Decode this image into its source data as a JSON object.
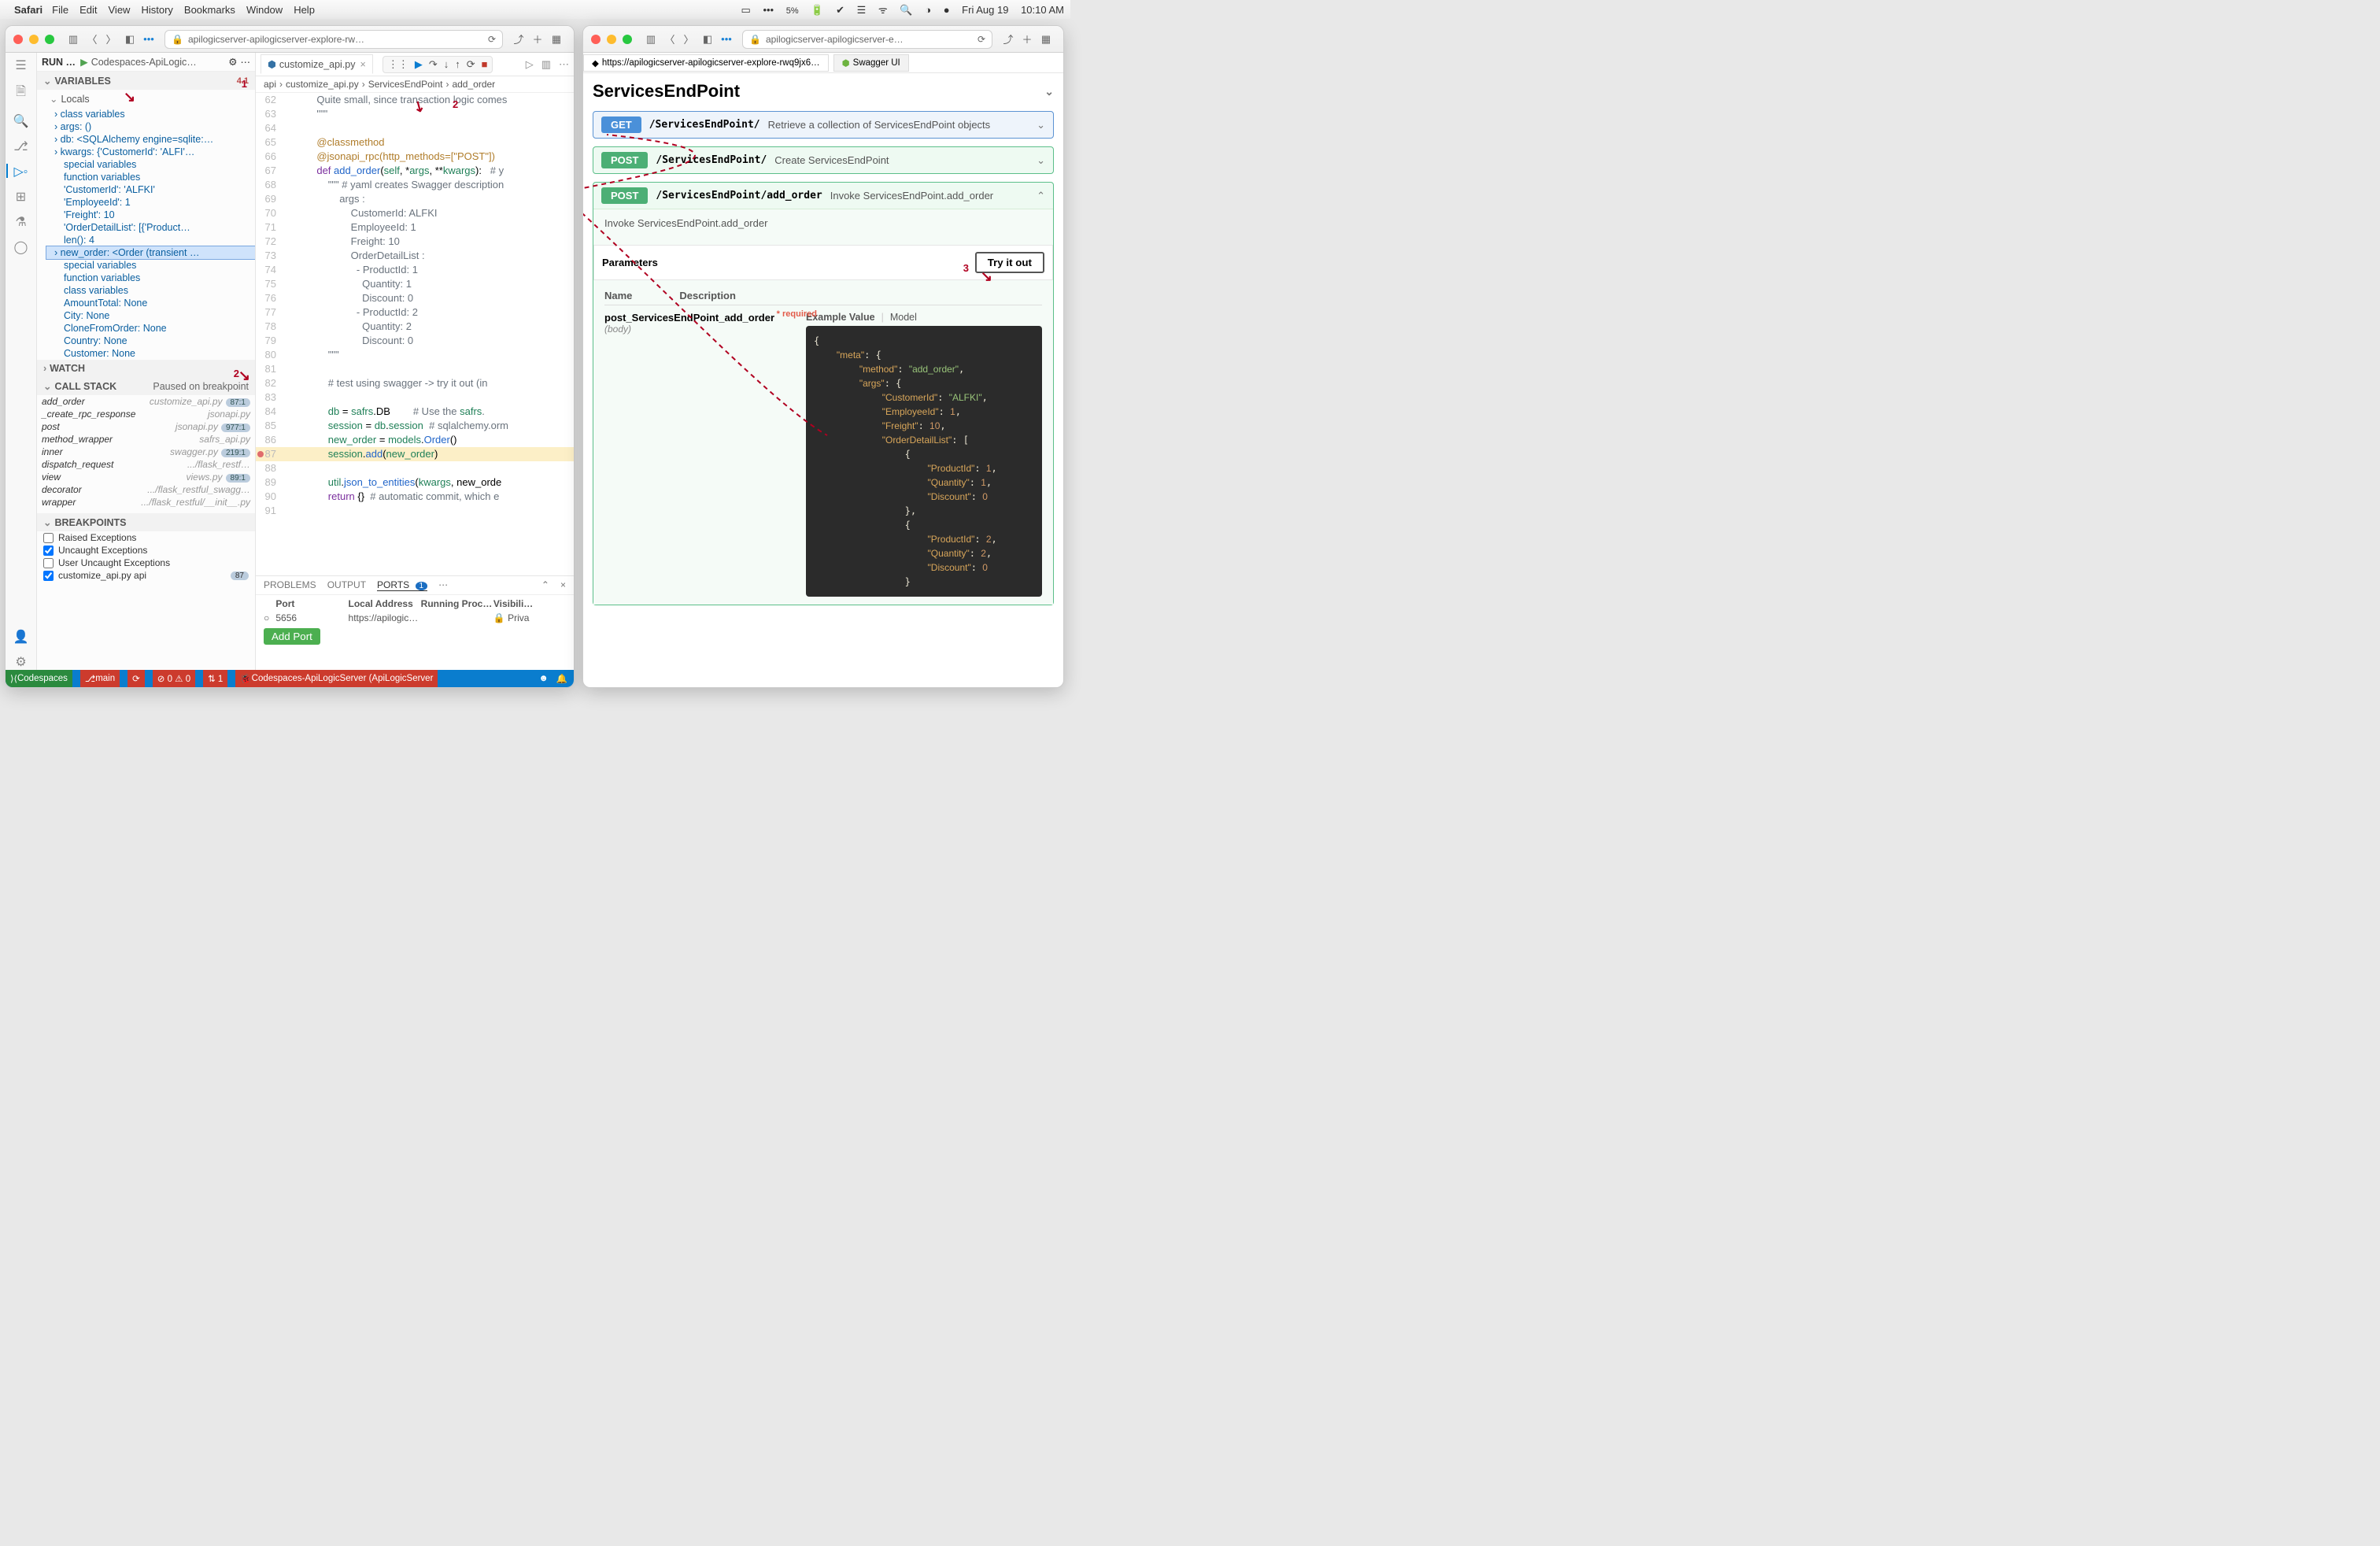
{
  "menubar": {
    "app": "Safari",
    "items": [
      "File",
      "Edit",
      "View",
      "History",
      "Bookmarks",
      "Window",
      "Help"
    ],
    "battery_pct": "5%",
    "date": "Fri Aug 19",
    "time": "10:10 AM"
  },
  "left_window": {
    "address": "apilogicserver-apilogicserver-explore-rw…",
    "run_cfg": "Codespaces-ApiLogic…",
    "run_label": "RUN …",
    "variables_title": "VARIABLES",
    "variables_badge": "4.1",
    "locals_title": "Locals",
    "locals": [
      {
        "name": "class variables",
        "val": ""
      },
      {
        "name": "args: ()",
        "val": ""
      },
      {
        "name": "db: <SQLAlchemy engine=sqlite:…",
        "val": ""
      },
      {
        "name": "kwargs: {'CustomerId': 'ALFI'…",
        "val": ""
      },
      {
        "name": "special variables",
        "val": "",
        "indent": 1
      },
      {
        "name": "function variables",
        "val": "",
        "indent": 1
      },
      {
        "name": "'CustomerId': 'ALFKI'",
        "val": "",
        "indent": 1
      },
      {
        "name": "'EmployeeId': 1",
        "val": "",
        "indent": 1
      },
      {
        "name": "'Freight': 10",
        "val": "",
        "indent": 1
      },
      {
        "name": "'OrderDetailList': [{'Product…",
        "val": "",
        "indent": 1
      },
      {
        "name": "len(): 4",
        "val": "",
        "indent": 1
      },
      {
        "name": "new_order: <Order (transient …",
        "val": "",
        "selected": true
      },
      {
        "name": "special variables",
        "val": "",
        "indent": 1
      },
      {
        "name": "function variables",
        "val": "",
        "indent": 1
      },
      {
        "name": "class variables",
        "val": "",
        "indent": 1
      },
      {
        "name": "AmountTotal: None",
        "val": "",
        "indent": 1
      },
      {
        "name": "City: None",
        "val": "",
        "indent": 1
      },
      {
        "name": "CloneFromOrder: None",
        "val": "",
        "indent": 1
      },
      {
        "name": "Country: None",
        "val": "",
        "indent": 1
      },
      {
        "name": "Customer: None",
        "val": "",
        "indent": 1
      }
    ],
    "watch_title": "WATCH",
    "callstack_title": "CALL STACK",
    "callstack_status": "Paused on breakpoint",
    "callstack": [
      {
        "fn": "add_order",
        "file": "customize_api.py",
        "tag": "87:1"
      },
      {
        "fn": "_create_rpc_response",
        "file": "jsonapi.py",
        "tag": ""
      },
      {
        "fn": "post",
        "file": "jsonapi.py",
        "tag": "977:1"
      },
      {
        "fn": "method_wrapper",
        "file": "safrs_api.py",
        "tag": ""
      },
      {
        "fn": "inner",
        "file": "swagger.py",
        "tag": "219:1"
      },
      {
        "fn": "dispatch_request",
        "file": ".../flask_restf…",
        "tag": ""
      },
      {
        "fn": "view",
        "file": "views.py",
        "tag": "89:1"
      },
      {
        "fn": "decorator",
        "file": ".../flask_restful_swagg…",
        "tag": ""
      },
      {
        "fn": "wrapper",
        "file": ".../flask_restful/__init__.py",
        "tag": ""
      }
    ],
    "breakpoints_title": "BREAKPOINTS",
    "breakpoints": [
      {
        "label": "Raised Exceptions",
        "checked": false
      },
      {
        "label": "Uncaught Exceptions",
        "checked": true
      },
      {
        "label": "User Uncaught Exceptions",
        "checked": false
      },
      {
        "label": "customize_api.py  api",
        "checked": true,
        "tag": "87"
      }
    ],
    "tab_filename": "customize_api.py",
    "breadcrumb": [
      "api",
      "customize_api.py",
      "ServicesEndPoint",
      "add_order"
    ],
    "code": [
      {
        "n": 62,
        "t": "            Quite small, since transaction logic comes",
        "cls": "tok-cm"
      },
      {
        "n": 63,
        "t": "            \"\"\"",
        "cls": "tok-cm"
      },
      {
        "n": 64,
        "t": ""
      },
      {
        "n": 65,
        "t": "            @classmethod",
        "cls": "tok-dec"
      },
      {
        "n": 66,
        "t": "            @jsonapi_rpc(http_methods=[\"POST\"])",
        "cls": "tok-dec"
      },
      {
        "n": 67,
        "t": "            def add_order(self, *args, **kwargs):   # y",
        "mix": true
      },
      {
        "n": 68,
        "t": "                \"\"\" # yaml creates Swagger description",
        "cls": "tok-cm"
      },
      {
        "n": 69,
        "t": "                    args :",
        "cls": "tok-cm"
      },
      {
        "n": 70,
        "t": "                        CustomerId: ALFKI",
        "cls": "tok-cm"
      },
      {
        "n": 71,
        "t": "                        EmployeeId: 1",
        "cls": "tok-cm"
      },
      {
        "n": 72,
        "t": "                        Freight: 10",
        "cls": "tok-cm"
      },
      {
        "n": 73,
        "t": "                        OrderDetailList :",
        "cls": "tok-cm"
      },
      {
        "n": 74,
        "t": "                          - ProductId: 1",
        "cls": "tok-cm"
      },
      {
        "n": 75,
        "t": "                            Quantity: 1",
        "cls": "tok-cm"
      },
      {
        "n": 76,
        "t": "                            Discount: 0",
        "cls": "tok-cm"
      },
      {
        "n": 77,
        "t": "                          - ProductId: 2",
        "cls": "tok-cm"
      },
      {
        "n": 78,
        "t": "                            Quantity: 2",
        "cls": "tok-cm"
      },
      {
        "n": 79,
        "t": "                            Discount: 0",
        "cls": "tok-cm"
      },
      {
        "n": 80,
        "t": "                \"\"\"",
        "cls": "tok-cm"
      },
      {
        "n": 81,
        "t": ""
      },
      {
        "n": 82,
        "t": "                # test using swagger -> try it out (in",
        "cls": "tok-cm"
      },
      {
        "n": 83,
        "t": ""
      },
      {
        "n": 84,
        "t": "                db = safrs.DB        # Use the safrs.",
        "mix": true
      },
      {
        "n": 85,
        "t": "                session = db.session  # sqlalchemy.orm",
        "mix": true
      },
      {
        "n": 86,
        "t": "                new_order = models.Order()",
        "mix": true
      },
      {
        "n": 87,
        "t": "                session.add(new_order)",
        "mix": true,
        "hl": true,
        "bp": true
      },
      {
        "n": 88,
        "t": ""
      },
      {
        "n": 89,
        "t": "                util.json_to_entities(kwargs, new_orde",
        "mix": true
      },
      {
        "n": 90,
        "t": "                return {}  # automatic commit, which e",
        "mix": true
      },
      {
        "n": 91,
        "t": ""
      }
    ],
    "panel": {
      "tabs": [
        "PROBLEMS",
        "OUTPUT",
        "PORTS"
      ],
      "ports_count": "1",
      "headers": [
        "Port",
        "Local Address",
        "Running Proc…",
        "Visibili…"
      ],
      "row": {
        "port": "5656",
        "addr": "https://apilogic…",
        "proc": "",
        "vis": "🔒 Priva"
      },
      "add_port": "Add Port"
    },
    "statusbar": {
      "codespaces": "Codespaces",
      "branch": "main",
      "sync": "⟳",
      "errwarn": "⊘ 0 ⚠ 0",
      "port_fw": "⇅ 1",
      "debug_target": "Codespaces-ApiLogicServer (ApiLogicServer"
    }
  },
  "right_window": {
    "address": "apilogicserver-apilogicserver-e…",
    "tab_url": "https://apilogicserver-apilogicserver-explore-rwq9jx6…",
    "tab_title": "Swagger UI",
    "section_title": "ServicesEndPoint",
    "ops": [
      {
        "method": "GET",
        "cls": "get",
        "path": "/ServicesEndPoint/",
        "desc": "Retrieve a collection of ServicesEndPoint objects",
        "open": false
      },
      {
        "method": "POST",
        "cls": "post",
        "path": "/ServicesEndPoint/",
        "desc": "Create ServicesEndPoint",
        "open": false
      },
      {
        "method": "POST",
        "cls": "post",
        "path": "/ServicesEndPoint/add_order",
        "desc": "Invoke ServicesEndPoint.add_order",
        "open": true
      }
    ],
    "opbody": {
      "invoke": "Invoke ServicesEndPoint.add_order",
      "params_label": "Parameters",
      "tryit": "Try it out",
      "col_name": "Name",
      "col_desc": "Description",
      "param_name": "post_ServicesEndPoint_add_order",
      "param_required": "* required",
      "param_sub": "(body)",
      "example_label": "Example Value",
      "model_label": "Model"
    },
    "example_json": "{\n    \"meta\": {\n        \"method\": \"add_order\",\n        \"args\": {\n            \"CustomerId\": \"ALFKI\",\n            \"EmployeeId\": 1,\n            \"Freight\": 10,\n            \"OrderDetailList\": [\n                {\n                    \"ProductId\": 1,\n                    \"Quantity\": 1,\n                    \"Discount\": 0\n                },\n                {\n                    \"ProductId\": 2,\n                    \"Quantity\": 2,\n                    \"Discount\": 0\n                }"
  },
  "annotations": {
    "n1": "1",
    "n2": "2",
    "n2b": "2",
    "n3": "3"
  }
}
